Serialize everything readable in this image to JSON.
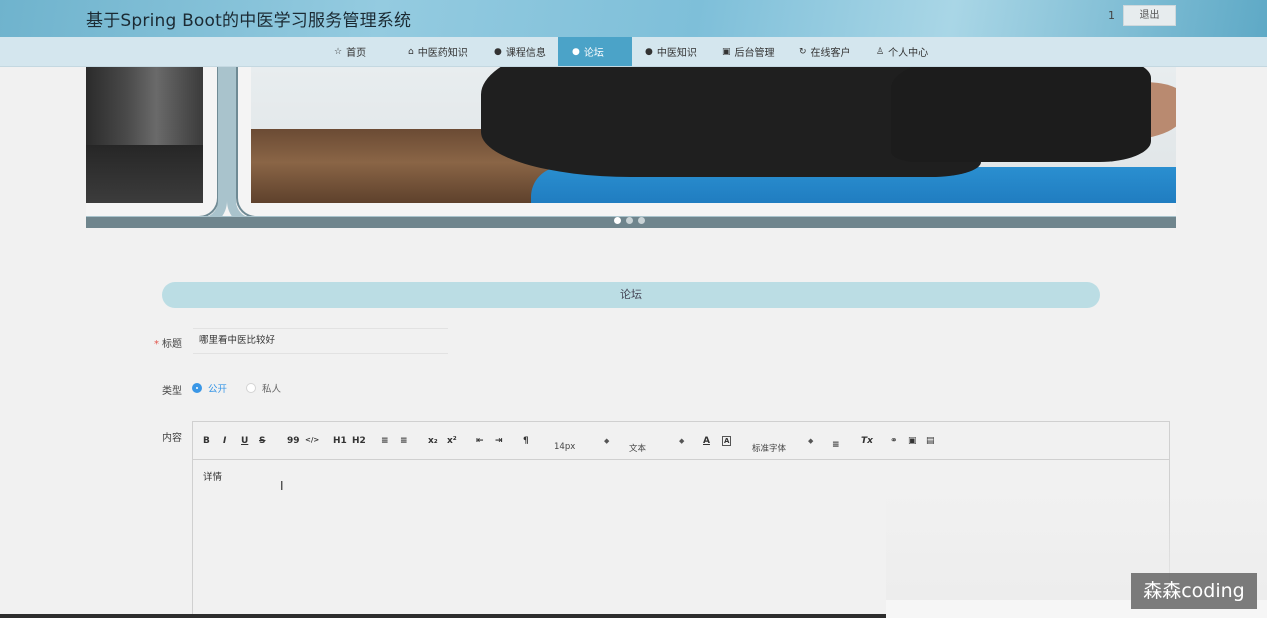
{
  "header": {
    "title": "基于Spring Boot的中医学习服务管理系统",
    "user": "1",
    "logout_label": "退出"
  },
  "nav": {
    "items": [
      {
        "label": "首页",
        "icon": "star-icon"
      },
      {
        "label": "中医药知识",
        "icon": "home-icon"
      },
      {
        "label": "课程信息",
        "icon": "info-icon"
      },
      {
        "label": "论坛",
        "icon": "circle-icon",
        "active": true
      },
      {
        "label": "中医知识",
        "icon": "info-icon"
      },
      {
        "label": "后台管理",
        "icon": "box-icon"
      },
      {
        "label": "在线客户",
        "icon": "headset-icon"
      },
      {
        "label": "个人中心",
        "icon": "user-icon"
      }
    ]
  },
  "banner": {
    "slide_count": 3,
    "active_slide": 1
  },
  "section": {
    "title": "论坛"
  },
  "form": {
    "title_label": "标题",
    "title_value": "哪里看中医比较好",
    "type_label": "类型",
    "type_options": [
      "公开",
      "私人"
    ],
    "type_selected": "公开",
    "content_label": "内容"
  },
  "editor": {
    "toolbar": {
      "bold": "B",
      "italic": "I",
      "underline": "U",
      "strike": "S",
      "quote": "99",
      "code": "</>",
      "h1": "H1",
      "h2": "H2",
      "ordered_list": "≡",
      "bullet_list": "≡",
      "subscript": "x₂",
      "superscript": "x²",
      "outdent": "⇤",
      "indent": "⇥",
      "direction": "¶",
      "size": "14px",
      "header": "文本",
      "font_color": "A",
      "background_color": "A",
      "font": "标准字体",
      "align": "≡",
      "clean": "Tx"
    },
    "content": "详情"
  },
  "watermark": "森森coding",
  "colors": {
    "nav_active": "#4ba3c8",
    "radio_selected": "#3a97e6",
    "required_mark": "#e2544b"
  }
}
